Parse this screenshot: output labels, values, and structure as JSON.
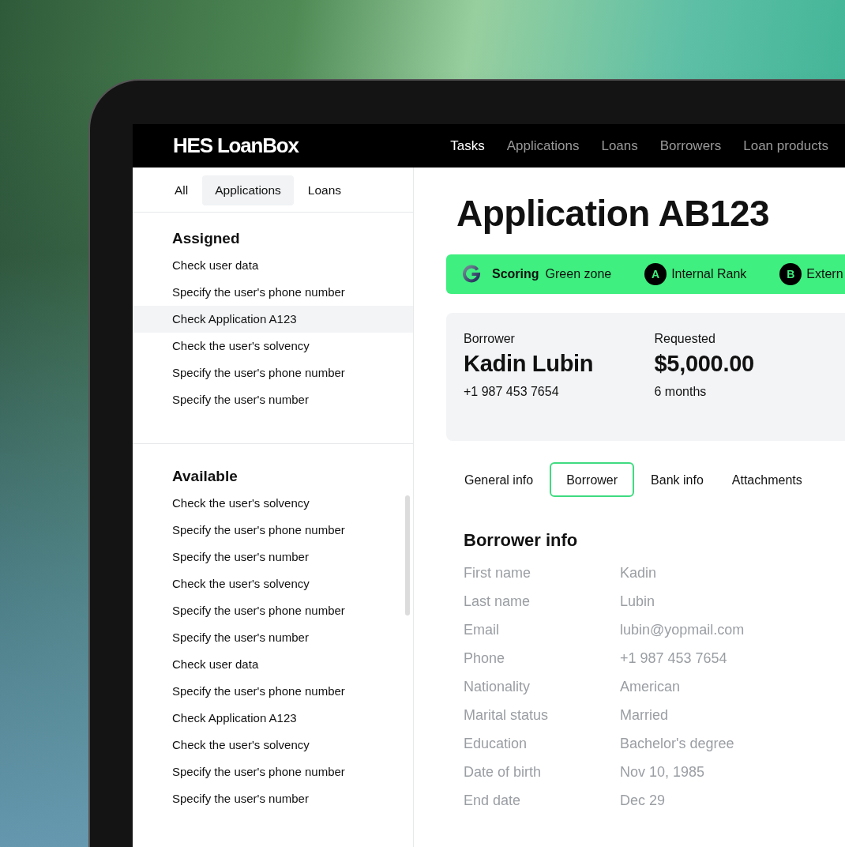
{
  "header": {
    "logo": "HES LoanBox",
    "nav": [
      {
        "label": "Tasks",
        "selected": true
      },
      {
        "label": "Applications",
        "selected": false
      },
      {
        "label": "Loans",
        "selected": false
      },
      {
        "label": "Borrowers",
        "selected": false
      },
      {
        "label": "Loan products",
        "selected": false
      }
    ]
  },
  "sidebar": {
    "tabs": [
      {
        "label": "All",
        "selected": false
      },
      {
        "label": "Applications",
        "selected": true
      },
      {
        "label": "Loans",
        "selected": false
      }
    ],
    "sections": [
      {
        "title": "Assigned",
        "items": [
          {
            "label": "Check user data",
            "selected": false
          },
          {
            "label": "Specify the user's phone number",
            "selected": false
          },
          {
            "label": "Check Application A123",
            "selected": true
          },
          {
            "label": "Check the user's solvency",
            "selected": false
          },
          {
            "label": "Specify the user's phone number",
            "selected": false
          },
          {
            "label": "Specify the user's number",
            "selected": false
          }
        ]
      },
      {
        "title": "Available",
        "items": [
          {
            "label": "Check the user's solvency",
            "selected": false
          },
          {
            "label": "Specify the user's phone number",
            "selected": false
          },
          {
            "label": "Specify the user's number",
            "selected": false
          },
          {
            "label": "Check the user's solvency",
            "selected": false
          },
          {
            "label": "Specify the user's phone number",
            "selected": false
          },
          {
            "label": "Specify the user's number",
            "selected": false
          },
          {
            "label": "Check user data",
            "selected": false
          },
          {
            "label": "Specify the user's phone number",
            "selected": false
          },
          {
            "label": "Check Application A123",
            "selected": false
          },
          {
            "label": "Check the user's solvency",
            "selected": false
          },
          {
            "label": "Specify the user's phone number",
            "selected": false
          },
          {
            "label": "Specify the user's number",
            "selected": false
          }
        ]
      }
    ]
  },
  "application": {
    "title": "Application AB123",
    "scoring": {
      "label": "Scoring",
      "value": "Green zone",
      "color": "#3fef7f"
    },
    "ranks": [
      {
        "badge": "A",
        "label": "Internal Rank"
      },
      {
        "badge": "B",
        "label": "Extern"
      }
    ],
    "summary": [
      {
        "label": "Borrower",
        "value": "Kadin Lubin",
        "detail": "+1 987 453 7654"
      },
      {
        "label": "Requested",
        "value": "$5,000.00",
        "detail": "6 months"
      }
    ],
    "tabs": [
      {
        "label": "General info",
        "selected": false
      },
      {
        "label": "Borrower",
        "selected": true
      },
      {
        "label": "Bank info",
        "selected": false
      },
      {
        "label": "Attachments",
        "selected": false
      }
    ],
    "section_title": "Borrower info",
    "fields": [
      {
        "label": "First name",
        "value": "Kadin"
      },
      {
        "label": "Last name",
        "value": "Lubin"
      },
      {
        "label": "Email",
        "value": "lubin@yopmail.com"
      },
      {
        "label": "Phone",
        "value": "+1 987 453 7654"
      },
      {
        "label": "Nationality",
        "value": "American"
      },
      {
        "label": "Marital status",
        "value": "Married"
      },
      {
        "label": "Education",
        "value": "Bachelor's degree"
      },
      {
        "label": "Date of birth",
        "value": "Nov 10, 1985"
      },
      {
        "label": "End date",
        "value": "Dec 29"
      }
    ]
  }
}
